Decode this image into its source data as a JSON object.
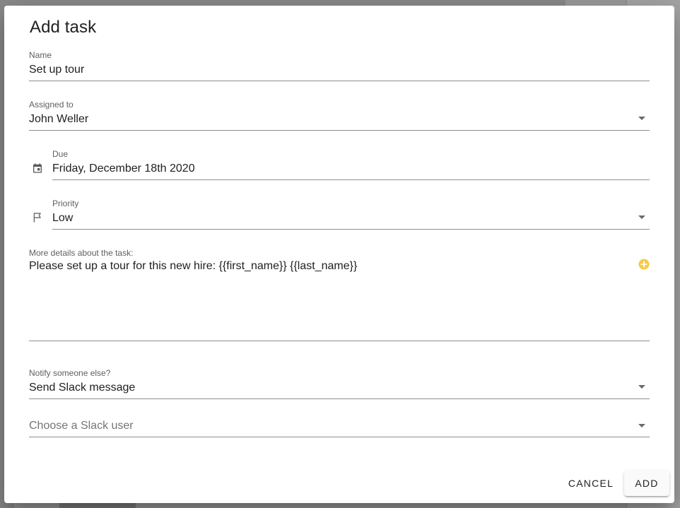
{
  "dialog": {
    "title": "Add task",
    "name": {
      "label": "Name",
      "value": "Set up tour"
    },
    "assigned_to": {
      "label": "Assigned to",
      "value": "John Weller"
    },
    "due": {
      "label": "Due",
      "value": "Friday, December 18th 2020",
      "icon": "calendar-icon"
    },
    "priority": {
      "label": "Priority",
      "value": "Low",
      "icon": "flag-icon"
    },
    "details": {
      "label": "More details about the task:",
      "value": "Please set up a tour for this new hire: {{first_name}} {{last_name}}",
      "icon": "add-circle-icon"
    },
    "notify": {
      "label": "Notify someone else?",
      "value": "Send Slack message"
    },
    "slack_user": {
      "placeholder": "Choose a Slack user"
    },
    "actions": {
      "cancel_label": "CANCEL",
      "add_label": "ADD"
    }
  },
  "colors": {
    "accent_icon": "#f7c948",
    "text": "#212121",
    "label": "#5f5f5f"
  }
}
